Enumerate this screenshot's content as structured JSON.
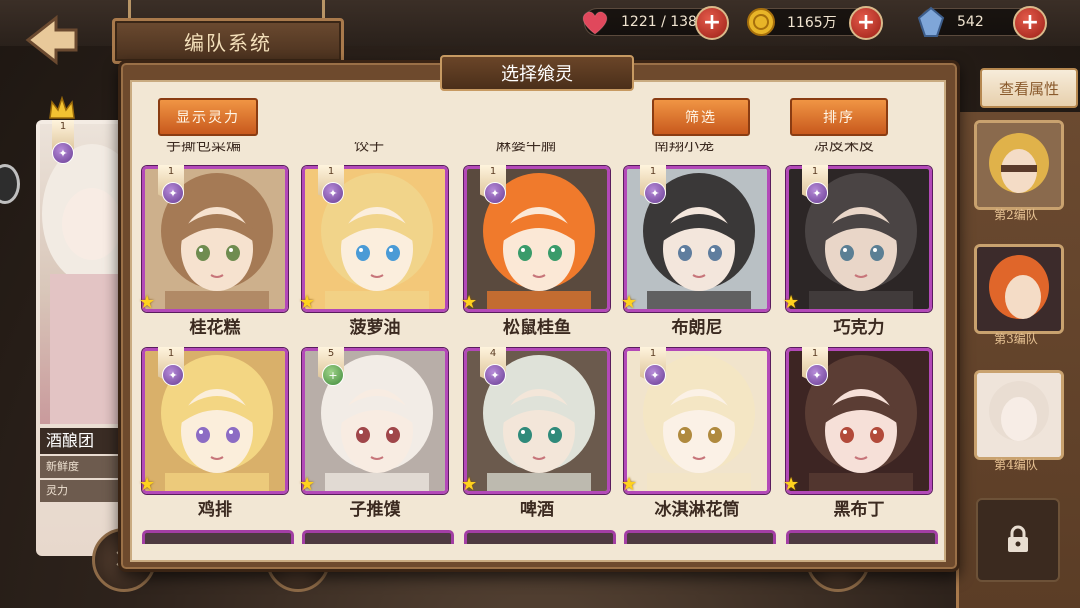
{
  "header": {
    "title": "编队系统",
    "back_icon": "back-arrow-icon"
  },
  "resources": [
    {
      "icon": "heart-icon",
      "value": "1221 / 138",
      "color": "#e0485c"
    },
    {
      "icon": "gold-coin-icon",
      "value": "1165万",
      "color": "#e8b528"
    },
    {
      "icon": "crystal-gem-icon",
      "value": "542",
      "color": "#7fa6d8"
    }
  ],
  "left_panel": {
    "name": "酒酿团",
    "stats": [
      "新鲜度",
      "灵力"
    ],
    "badge_level": "1"
  },
  "right_panel": {
    "view_attr_label": "查看属性",
    "teams": [
      {
        "label": "第2编队"
      },
      {
        "label": "第3编队"
      },
      {
        "label": "第4编队"
      }
    ],
    "locked_icon": "lock-icon"
  },
  "modal": {
    "title": "选择飨灵",
    "show_power_label": "显示灵力",
    "filter_label": "筛选",
    "sort_label": "排序",
    "clipped_row_names": [
      "手撕包菜煸",
      "饺子",
      "麻婆牛腩",
      "南翔小笼",
      "凉皮米皮"
    ]
  },
  "cards": [
    {
      "name": "桂花糕",
      "tag": "1",
      "rarity": "star-icon",
      "hair": "#a57a55",
      "bg": "#cdb08c",
      "skin": "#f6e2cf",
      "eye": "#6f8c50"
    },
    {
      "name": "菠萝油",
      "tag": "1",
      "rarity": "star-icon",
      "hair": "#f1d48a",
      "bg": "#f3c879",
      "skin": "#fbeedd",
      "eye": "#4a9bd6"
    },
    {
      "name": "松鼠桂鱼",
      "tag": "1",
      "rarity": "star-icon",
      "hair": "#f07a2c",
      "bg": "#5a4a3e",
      "skin": "#fbe8d6",
      "eye": "#3a9b6a"
    },
    {
      "name": "布朗尼",
      "tag": "1",
      "rarity": "star-icon",
      "hair": "#3a3838",
      "bg": "#b9c0c4",
      "skin": "#f3e6dc",
      "eye": "#5f7d9e"
    },
    {
      "name": "巧克力",
      "tag": "1",
      "rarity": "star-icon",
      "hair": "#4a4444",
      "bg": "#2c2626",
      "skin": "#e9d6c8",
      "eye": "#5b7f94"
    },
    {
      "name": "鸡排",
      "tag": "1",
      "rarity": "star-icon",
      "hair": "#f3d683",
      "bg": "#d9b06a",
      "skin": "#fbeedb",
      "eye": "#8c6cc4"
    },
    {
      "name": "子推馍",
      "tag": "5",
      "rarity": "plus-icon",
      "hair": "#f2ece6",
      "bg": "#b8aea8",
      "skin": "#f8ece2",
      "eye": "#a0464a"
    },
    {
      "name": "啤酒",
      "tag": "4",
      "rarity": "star-icon",
      "hair": "#dfe2d9",
      "bg": "#6b5a4d",
      "skin": "#f3e6d9",
      "eye": "#2f8a7a"
    },
    {
      "name": "冰淇淋花筒",
      "tag": "1",
      "rarity": "star-icon",
      "hair": "#f4e6c4",
      "bg": "#f1e4cc",
      "skin": "#fbf1e6",
      "eye": "#b08a3e"
    },
    {
      "name": "黑布丁",
      "tag": "1",
      "rarity": "star-icon",
      "hair": "#5b3d34",
      "bg": "#3d2523",
      "skin": "#f6e0d8",
      "eye": "#b24a3a"
    }
  ]
}
